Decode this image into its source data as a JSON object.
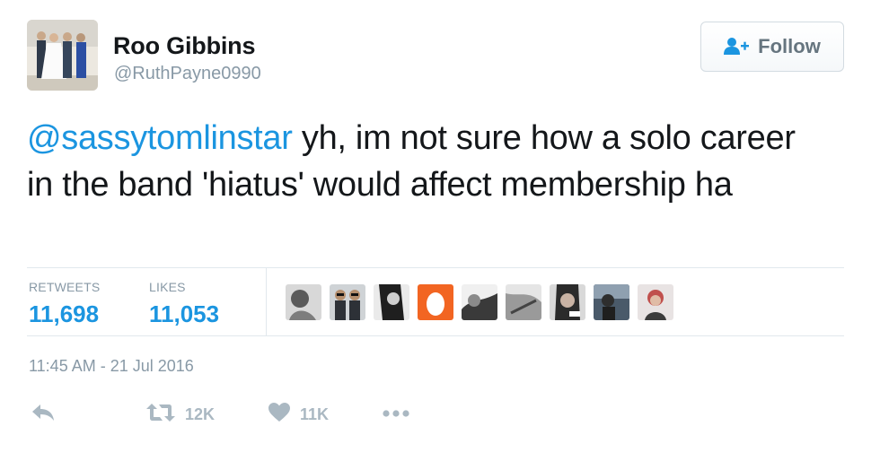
{
  "user": {
    "name": "Roo Gibbins",
    "handle": "@RuthPayne0990"
  },
  "follow_button": {
    "label": "Follow",
    "icon": "follow-user-plus-icon"
  },
  "tweet": {
    "mention": "@sassytomlinstar",
    "text": " yh, im not sure how a solo career in the band 'hiatus' would affect membership ha"
  },
  "stats": {
    "retweets_label": "RETWEETS",
    "retweets_value": "11,698",
    "likes_label": "LIKES",
    "likes_value": "11,053"
  },
  "timestamp": "11:45 AM - 21 Jul 2016",
  "actions": {
    "reply_icon": "reply-icon",
    "retweet_count": "12K",
    "like_count": "11K",
    "more_icon": "more-dots-icon"
  },
  "colors": {
    "link": "#1b95e0",
    "muted": "#8899a6",
    "action": "#aab8c2",
    "text": "#14171a"
  }
}
